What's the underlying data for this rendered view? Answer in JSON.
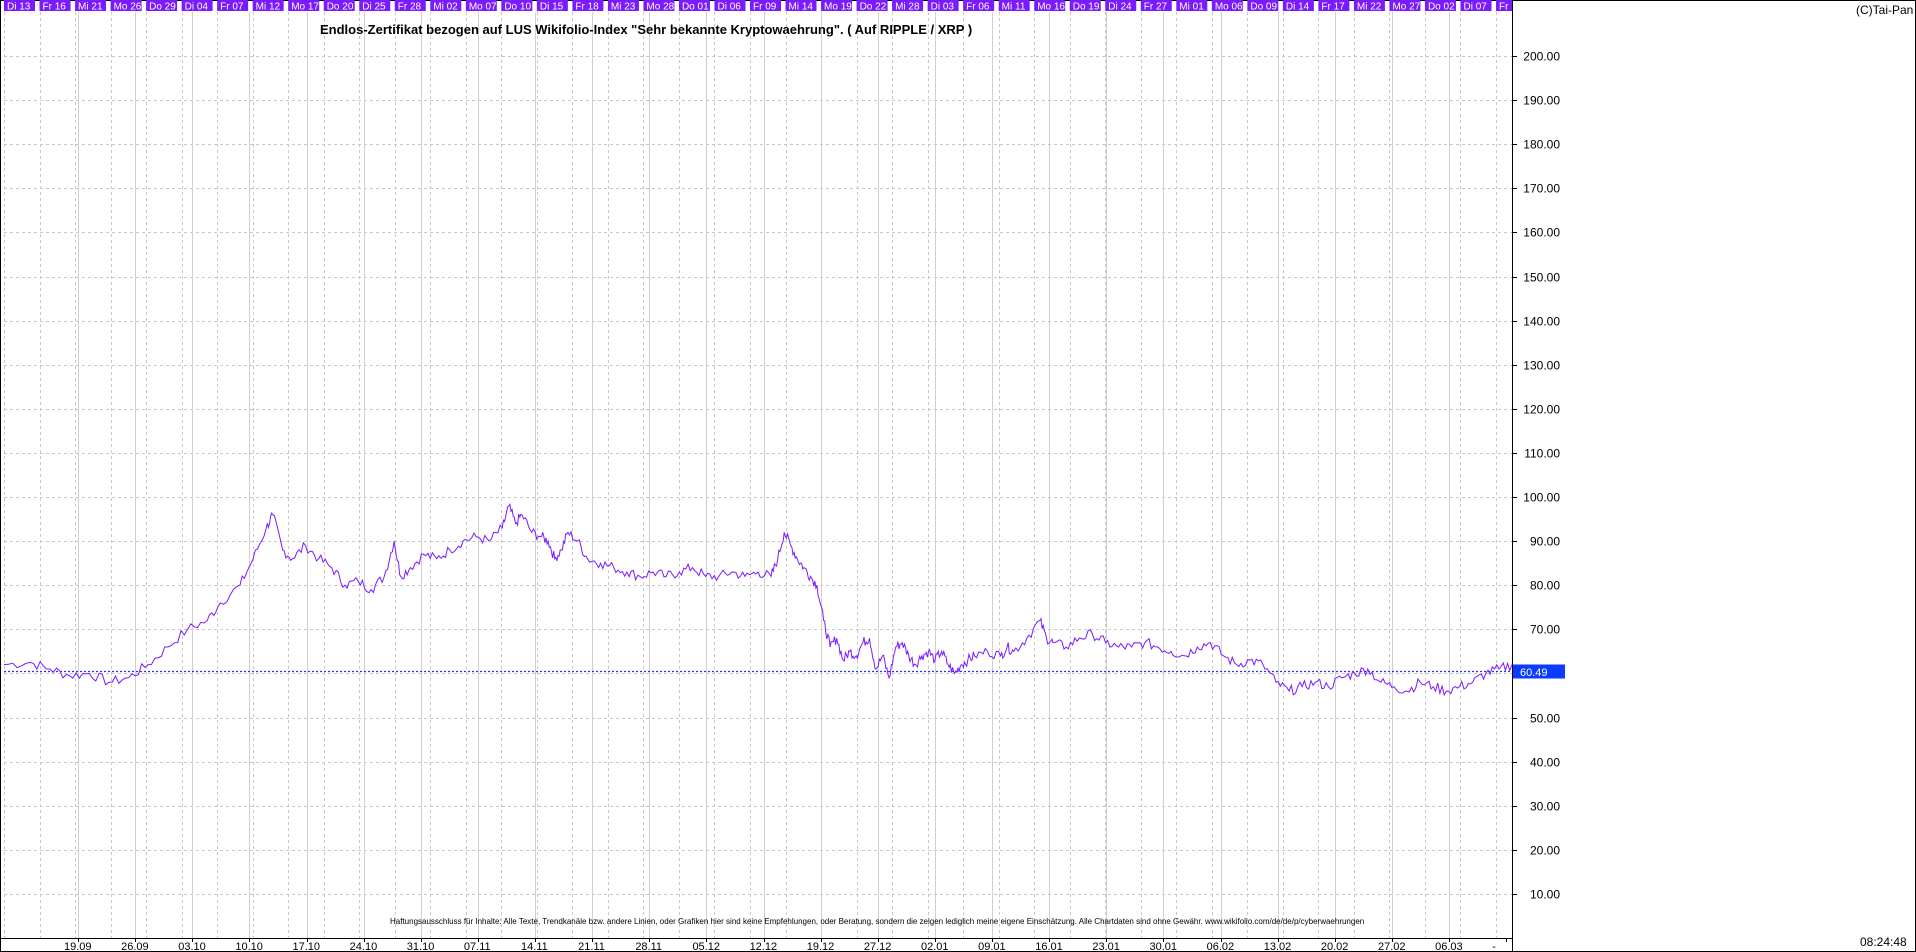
{
  "copyright": "(C)Tai-Pan",
  "clock": "08:24:48",
  "disclaimer": "Haftungsausschluss für Inhalte: Alle Texte, Trendkanäle bzw. andere Linien, oder Grafiken hier sind keine Empfehlungen, oder Beratung, sondern die zeigen lediglich meine eigene Einschätzung. Alle Chartdaten sind ohne Gewähr. www.wikifolio.com/de/de/p/cyberwaehrungen",
  "colors": {
    "line": "#7a1bff",
    "tab_bg": "#7a1bff",
    "tab_text": "#ffffff",
    "grid": "#c8c8c8",
    "ref_line": "#2233ff",
    "price_badge": "#0a3cff"
  },
  "chart_data": {
    "type": "line",
    "title": "Endlos-Zertifikat bezogen auf LUS Wikifolio-Index \"Sehr bekannte Kryptowaehrung\". ( Auf RIPPLE / XRP )",
    "grid": true,
    "ylim": [
      0,
      210
    ],
    "y_ticks": [
      "10.00",
      "20.00",
      "30.00",
      "40.00",
      "50.00",
      "60.00",
      "70.00",
      "80.00",
      "90.00",
      "100.00",
      "110.00",
      "120.00",
      "130.00",
      "140.00",
      "150.00",
      "160.00",
      "170.00",
      "180.00",
      "190.00",
      "200.00"
    ],
    "top_day_labels": [
      "Di 13",
      "Fr 16",
      "Mi 21",
      "Mo 26",
      "Do 29",
      "Di 04",
      "Fr 07",
      "Mi 12",
      "Mo 17",
      "Do 20",
      "Di 25",
      "Fr 28",
      "Mi 02",
      "Mo 07",
      "Do 10",
      "Di 15",
      "Fr 18",
      "Mi 23",
      "Mo 28",
      "Do 01",
      "Di 06",
      "Fr 09",
      "Mi 14",
      "Mo 19",
      "Do 22",
      "Mi 28",
      "Di 03",
      "Fr 06",
      "Mi 11",
      "Mo 16",
      "Do 19",
      "Di 24",
      "Fr 27",
      "Mi 01",
      "Mo 06",
      "Do 09",
      "Di 14",
      "Fr 17",
      "Mi 22",
      "Mo 27",
      "Do 02",
      "Di 07",
      "Fr"
    ],
    "bottom_date_labels": [
      "19.09",
      "26.09",
      "03.10",
      "10.10",
      "17.10",
      "24.10",
      "31.10",
      "07.11",
      "14.11",
      "21.11",
      "28.11",
      "05.12",
      "12.12",
      "19.12",
      "27.12",
      "02.01",
      "09.01",
      "16.01",
      "23.01",
      "30.01",
      "06.02",
      "13.02",
      "20.02",
      "27.02",
      "06.03",
      "-"
    ],
    "reference_line": 60.49,
    "last_value": "60.49",
    "x_range": [
      0,
      460
    ],
    "series": [
      {
        "values": [
          [
            0,
            62
          ],
          [
            8,
            62.5
          ],
          [
            14,
            61
          ],
          [
            20,
            59.5
          ],
          [
            26,
            60
          ],
          [
            32,
            58
          ],
          [
            38,
            59
          ],
          [
            44,
            62
          ],
          [
            50,
            66
          ],
          [
            56,
            70
          ],
          [
            62,
            72
          ],
          [
            66,
            76
          ],
          [
            72,
            80
          ],
          [
            76,
            86
          ],
          [
            80,
            93
          ],
          [
            82,
            96
          ],
          [
            85,
            88
          ],
          [
            88,
            86
          ],
          [
            92,
            89
          ],
          [
            96,
            86
          ],
          [
            100,
            84
          ],
          [
            104,
            80
          ],
          [
            108,
            81
          ],
          [
            112,
            79
          ],
          [
            116,
            82
          ],
          [
            119,
            90
          ],
          [
            121,
            82
          ],
          [
            124,
            84
          ],
          [
            128,
            87
          ],
          [
            132,
            86
          ],
          [
            136,
            88
          ],
          [
            140,
            90
          ],
          [
            144,
            91
          ],
          [
            148,
            90
          ],
          [
            152,
            93
          ],
          [
            154,
            98
          ],
          [
            156,
            94
          ],
          [
            158,
            96
          ],
          [
            161,
            92
          ],
          [
            164,
            91
          ],
          [
            166,
            90
          ],
          [
            168,
            86
          ],
          [
            170,
            88
          ],
          [
            172,
            92
          ],
          [
            175,
            90
          ],
          [
            178,
            86
          ],
          [
            182,
            85
          ],
          [
            186,
            84
          ],
          [
            190,
            83
          ],
          [
            194,
            82
          ],
          [
            198,
            83
          ],
          [
            202,
            82
          ],
          [
            206,
            83
          ],
          [
            210,
            84
          ],
          [
            214,
            82
          ],
          [
            218,
            82
          ],
          [
            222,
            83
          ],
          [
            226,
            82
          ],
          [
            230,
            83
          ],
          [
            234,
            82
          ],
          [
            236,
            86
          ],
          [
            238,
            92
          ],
          [
            240,
            89
          ],
          [
            242,
            86
          ],
          [
            244,
            84
          ],
          [
            246,
            82
          ],
          [
            248,
            80
          ],
          [
            250,
            72
          ],
          [
            252,
            66
          ],
          [
            254,
            68
          ],
          [
            256,
            63
          ],
          [
            258,
            65
          ],
          [
            260,
            64
          ],
          [
            262,
            67
          ],
          [
            264,
            68
          ],
          [
            266,
            61
          ],
          [
            268,
            64
          ],
          [
            270,
            59
          ],
          [
            272,
            66
          ],
          [
            274,
            67
          ],
          [
            276,
            64
          ],
          [
            278,
            62
          ],
          [
            280,
            64
          ],
          [
            282,
            65
          ],
          [
            284,
            63
          ],
          [
            286,
            65
          ],
          [
            288,
            62
          ],
          [
            290,
            60
          ],
          [
            292,
            62
          ],
          [
            294,
            63
          ],
          [
            296,
            64
          ],
          [
            300,
            65
          ],
          [
            304,
            64
          ],
          [
            306,
            66
          ],
          [
            308,
            65
          ],
          [
            312,
            68
          ],
          [
            316,
            72
          ],
          [
            318,
            68
          ],
          [
            320,
            67
          ],
          [
            324,
            66
          ],
          [
            328,
            68
          ],
          [
            332,
            69
          ],
          [
            336,
            67
          ],
          [
            340,
            66
          ],
          [
            344,
            66
          ],
          [
            348,
            67
          ],
          [
            352,
            66
          ],
          [
            356,
            65
          ],
          [
            360,
            64
          ],
          [
            364,
            66
          ],
          [
            368,
            67
          ],
          [
            372,
            64
          ],
          [
            376,
            62
          ],
          [
            380,
            63
          ],
          [
            384,
            62
          ],
          [
            388,
            58
          ],
          [
            392,
            56
          ],
          [
            396,
            57
          ],
          [
            400,
            58
          ],
          [
            404,
            57
          ],
          [
            408,
            59
          ],
          [
            412,
            60
          ],
          [
            416,
            61
          ],
          [
            420,
            58
          ],
          [
            424,
            57
          ],
          [
            428,
            56
          ],
          [
            432,
            58
          ],
          [
            436,
            57
          ],
          [
            440,
            56
          ],
          [
            444,
            57
          ],
          [
            448,
            58
          ],
          [
            452,
            60
          ],
          [
            456,
            61
          ],
          [
            460,
            62
          ]
        ]
      }
    ]
  }
}
